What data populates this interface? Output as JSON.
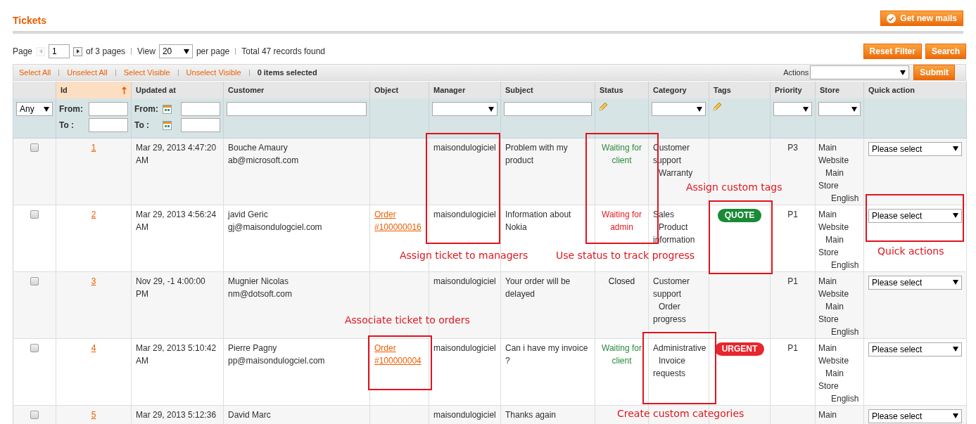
{
  "title": "Tickets",
  "get_mail_button": "Get new mails",
  "pager": {
    "page_label": "Page",
    "prev_disabled": true,
    "page": "1",
    "of_pages": "of 3 pages",
    "view_label": "View",
    "per_page": "20",
    "per_page_label": "per page",
    "total": "Total 47 records found"
  },
  "filter_buttons": [
    "Reset Filter",
    "Search"
  ],
  "massaction": {
    "links": [
      "Select All",
      "Unselect All",
      "Select Visible",
      "Unselect Visible"
    ],
    "selected_count": "0 items selected",
    "actions_label": "Actions",
    "submit": "Submit"
  },
  "columns": [
    {
      "sorted": false
    },
    {
      "label": "Id",
      "sorted": true
    },
    {
      "label": "Updated at",
      "sorted": false
    },
    {
      "label": "Customer",
      "sorted": false
    },
    {
      "label": "Object",
      "sorted": false
    },
    {
      "label": "Manager",
      "sorted": false
    },
    {
      "label": "Subject",
      "sorted": false
    },
    {
      "label": "Status",
      "sorted": false
    },
    {
      "label": "Category",
      "sorted": false
    },
    {
      "label": "Tags",
      "sorted": false
    },
    {
      "label": "Priority",
      "sorted": false
    },
    {
      "label": "Store",
      "sorted": false
    },
    {
      "label": "Quick action",
      "sorted": false
    }
  ],
  "filters": [
    {
      "kind": "select",
      "value": "Any"
    },
    {
      "kind": "range",
      "from_label": "From:",
      "to_label": "To :"
    },
    {
      "kind": "date",
      "from_label": "From:",
      "to_label": "To :"
    },
    {
      "kind": "text"
    },
    {
      "kind": "none"
    },
    {
      "kind": "select"
    },
    {
      "kind": "text"
    },
    {
      "kind": "edit"
    },
    {
      "kind": "select"
    },
    {
      "kind": "edit"
    },
    {
      "kind": "select"
    },
    {
      "kind": "select"
    },
    {
      "kind": "none"
    }
  ],
  "rows": [
    {
      "checked": false,
      "id": "1",
      "updated": "Mar 29, 2013 4:47:20 AM",
      "customer": [
        "Bouche Amaury",
        "ab@microsoft.com"
      ],
      "object": "",
      "manager": "maisondulogiciel",
      "subject": "Problem with my product",
      "status": {
        "text": "Waiting for client",
        "kind": "client"
      },
      "category": [
        "Customer support",
        "Warranty"
      ],
      "tag": null,
      "priority": "P3",
      "store": [
        "Main Website",
        "Main Store",
        "English"
      ],
      "quick_action": "Please select"
    },
    {
      "checked": false,
      "id": "2",
      "updated": "Mar 29, 2013 4:56:24 AM",
      "customer": [
        "javid Geric",
        "gj@maisondulogciel.com"
      ],
      "object": "Order #100000016",
      "manager": "maisondulogiciel",
      "subject": "Information about Nokia",
      "status": {
        "text": "Waiting for admin",
        "kind": "admin"
      },
      "category": [
        "Sales",
        "Product information"
      ],
      "tag": {
        "label": "QUOTE",
        "color": "#1a8a36"
      },
      "priority": "P1",
      "store": [
        "Main Website",
        "Main Store",
        "English"
      ],
      "quick_action": "Please select"
    },
    {
      "checked": false,
      "id": "3",
      "updated": "Nov 29, -1 4:00:00 PM",
      "customer": [
        "Mugnier Nicolas",
        "nm@dotsoft.com"
      ],
      "object": "",
      "manager": "maisondulogiciel",
      "subject": "Your order will be delayed",
      "status": {
        "text": "Closed",
        "kind": "closed"
      },
      "category": [
        "Customer support",
        "Order progress"
      ],
      "tag": null,
      "priority": "P1",
      "store": [
        "Main Website",
        "Main Store",
        "English"
      ],
      "quick_action": "Please select"
    },
    {
      "checked": false,
      "id": "4",
      "updated": "Mar 29, 2013 5:10:42 AM",
      "customer": [
        "Pierre Pagny",
        "pp@maisondulogciel.com"
      ],
      "object": "Order #100000004",
      "manager": "maisondulogiciel",
      "subject": "Can i have my invoice ?",
      "status": {
        "text": "Waiting for client",
        "kind": "client"
      },
      "category": [
        "Administrative",
        "Invoice requests"
      ],
      "tag": {
        "label": "URGENT",
        "color": "#e8262d"
      },
      "priority": "P1",
      "store": [
        "Main Website",
        "Main Store",
        "English"
      ],
      "quick_action": "Please select"
    },
    {
      "checked": false,
      "id": "5",
      "updated": "Mar 29, 2013 5:12:36",
      "customer": [
        "David Marc"
      ],
      "object": "",
      "manager": "maisondulogiciel",
      "subject": "Thanks again",
      "status": null,
      "category": [],
      "tag": null,
      "priority": "",
      "store": [
        "Main"
      ],
      "quick_action": "Please select"
    }
  ],
  "annotations": [
    {
      "text": "Assign ticket to managers"
    },
    {
      "text": "Use status to track progress"
    },
    {
      "text": "Assign custom tags"
    },
    {
      "text": "Quick actions"
    },
    {
      "text": "Associate ticket to orders"
    },
    {
      "text": "Create custom categories"
    }
  ]
}
